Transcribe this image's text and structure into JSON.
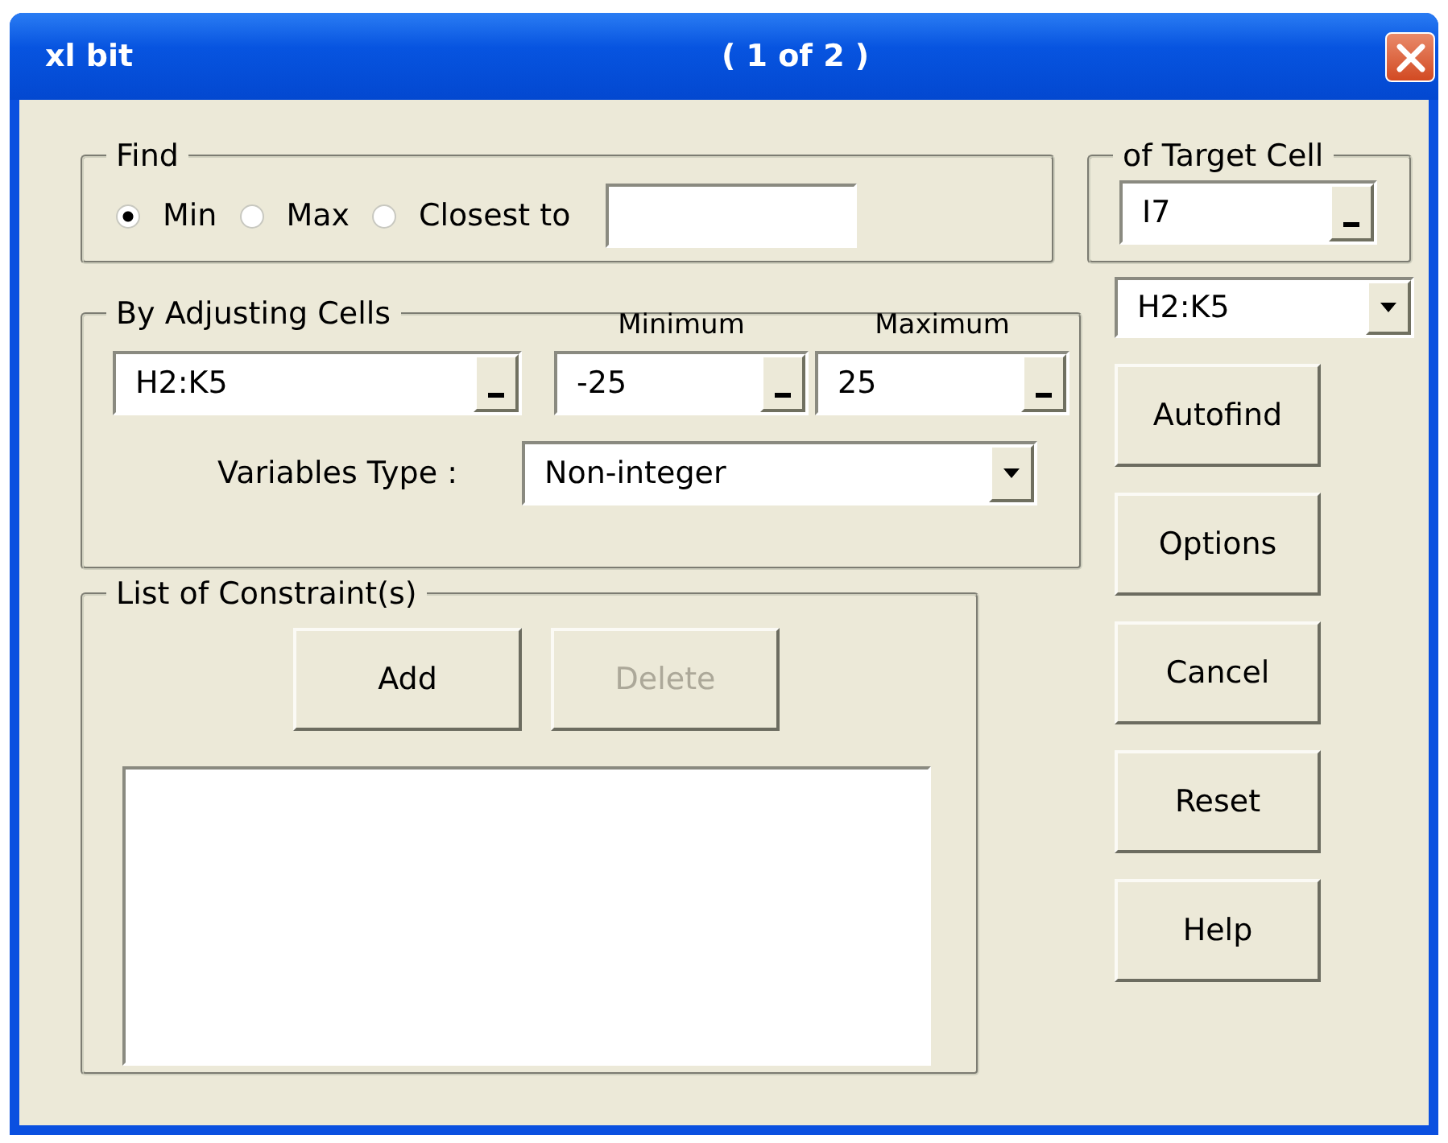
{
  "window": {
    "title": "xl bit",
    "page_indicator": "( 1 of 2 )"
  },
  "find": {
    "label": "Find",
    "options": [
      {
        "label": "Min",
        "selected": true
      },
      {
        "label": "Max",
        "selected": false
      },
      {
        "label": "Closest to",
        "selected": false
      }
    ]
  },
  "target_cell": {
    "label": "of Target Cell",
    "value": "I7"
  },
  "range_dropdown": {
    "value": "H2:K5"
  },
  "adjusting": {
    "label": "By Adjusting Cells",
    "cells": "H2:K5",
    "minimum_label": "Minimum",
    "minimum": "-25",
    "maximum_label": "Maximum",
    "maximum": "25",
    "variables_type_label": "Variables Type :",
    "variables_type": "Non-integer"
  },
  "constraints": {
    "label": "List of Constraint(s)",
    "buttons": [
      {
        "label": "Add",
        "disabled": false
      },
      {
        "label": "Delete",
        "disabled": true
      }
    ]
  },
  "side_buttons": [
    "Autofind",
    "Options",
    "Cancel",
    "Reset",
    "Help"
  ]
}
